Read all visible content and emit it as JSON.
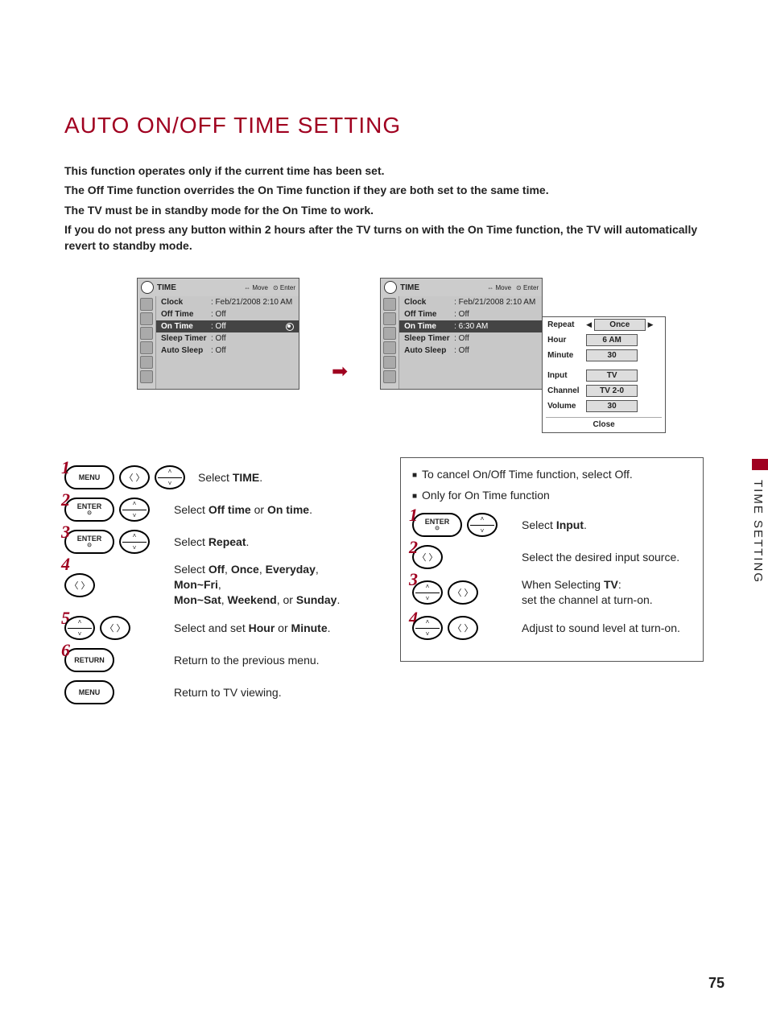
{
  "title": "AUTO ON/OFF TIME SETTING",
  "intro": {
    "line1": "This function operates only if the current time has been set.",
    "line2a": "The ",
    "line2b": "Off Time",
    "line2c": " function overrides the ",
    "line2d": "On Time",
    "line2e": " function if they are both set to the same time.",
    "line3a": "The TV must be in standby mode for the ",
    "line3b": "On Time",
    "line3c": " to work.",
    "line4a": "If you do not press any button within 2 hours after the TV turns on with the ",
    "line4b": "On Time",
    "line4c": " function, the TV will automatically revert to standby mode."
  },
  "panels": {
    "header_title": "TIME",
    "hint_move": "Move",
    "hint_enter": "Enter",
    "rows": {
      "clock_lbl": "Clock",
      "clock_val": ": Feb/21/2008  2:10 AM",
      "off_lbl": "Off Time",
      "off_val": ": Off",
      "on_lbl": "On Time",
      "on_val1": ": Off",
      "on_val2": ": 6:30 AM",
      "sleep_lbl": "Sleep Timer",
      "sleep_val": ": Off",
      "auto_lbl": "Auto Sleep",
      "auto_val": ": Off"
    }
  },
  "popup": {
    "repeat_lbl": "Repeat",
    "repeat_val": "Once",
    "hour_lbl": "Hour",
    "hour_val": "6 AM",
    "minute_lbl": "Minute",
    "minute_val": "30",
    "input_lbl": "Input",
    "input_val": "TV",
    "channel_lbl": "Channel",
    "channel_val": "TV 2-0",
    "volume_lbl": "Volume",
    "volume_val": "30",
    "close": "Close"
  },
  "buttons": {
    "menu": "MENU",
    "enter": "ENTER",
    "return": "RETURN"
  },
  "steps_left": {
    "s1a": "Select ",
    "s1b": "TIME",
    "s1c": ".",
    "s2a": "Select ",
    "s2b": "Off time",
    "s2c": " or ",
    "s2d": "On time",
    "s2e": ".",
    "s3a": "Select ",
    "s3b": "Repeat",
    "s3c": ".",
    "s4a": "Select ",
    "s4b": "Off",
    "s4c": ", ",
    "s4d": "Once",
    "s4e": ", ",
    "s4f": "Everyday",
    "s4g": ", ",
    "s4h": "Mon~Fri",
    "s4i": ", ",
    "s4j": "Mon~Sat",
    "s4k": ", ",
    "s4l": "Weekend",
    "s4m": ", or ",
    "s4n": "Sunday",
    "s4o": ".",
    "s5a": "Select and set ",
    "s5b": "Hour",
    "s5c": " or ",
    "s5d": "Minute",
    "s5e": ".",
    "s6": "Return to the previous menu.",
    "s7": "Return to TV viewing."
  },
  "right_panel": {
    "bullet1a": "To cancel ",
    "bullet1b": "On/Off Time",
    "bullet1c": " function, select ",
    "bullet1d": "Off",
    "bullet1e": ".",
    "bullet2": "Only for On Time function",
    "r1a": "Select ",
    "r1b": "Input",
    "r1c": ".",
    "r2": "Select the desired input source.",
    "r3a": "When Selecting ",
    "r3b": "TV",
    "r3c": ":",
    "r3d": "set the channel at turn-on.",
    "r4": "Adjust to sound level at turn-on."
  },
  "side_tab": "TIME SETTING",
  "page_number": "75",
  "nums": {
    "n1": "1",
    "n2": "2",
    "n3": "3",
    "n4": "4",
    "n5": "5",
    "n6": "6"
  }
}
